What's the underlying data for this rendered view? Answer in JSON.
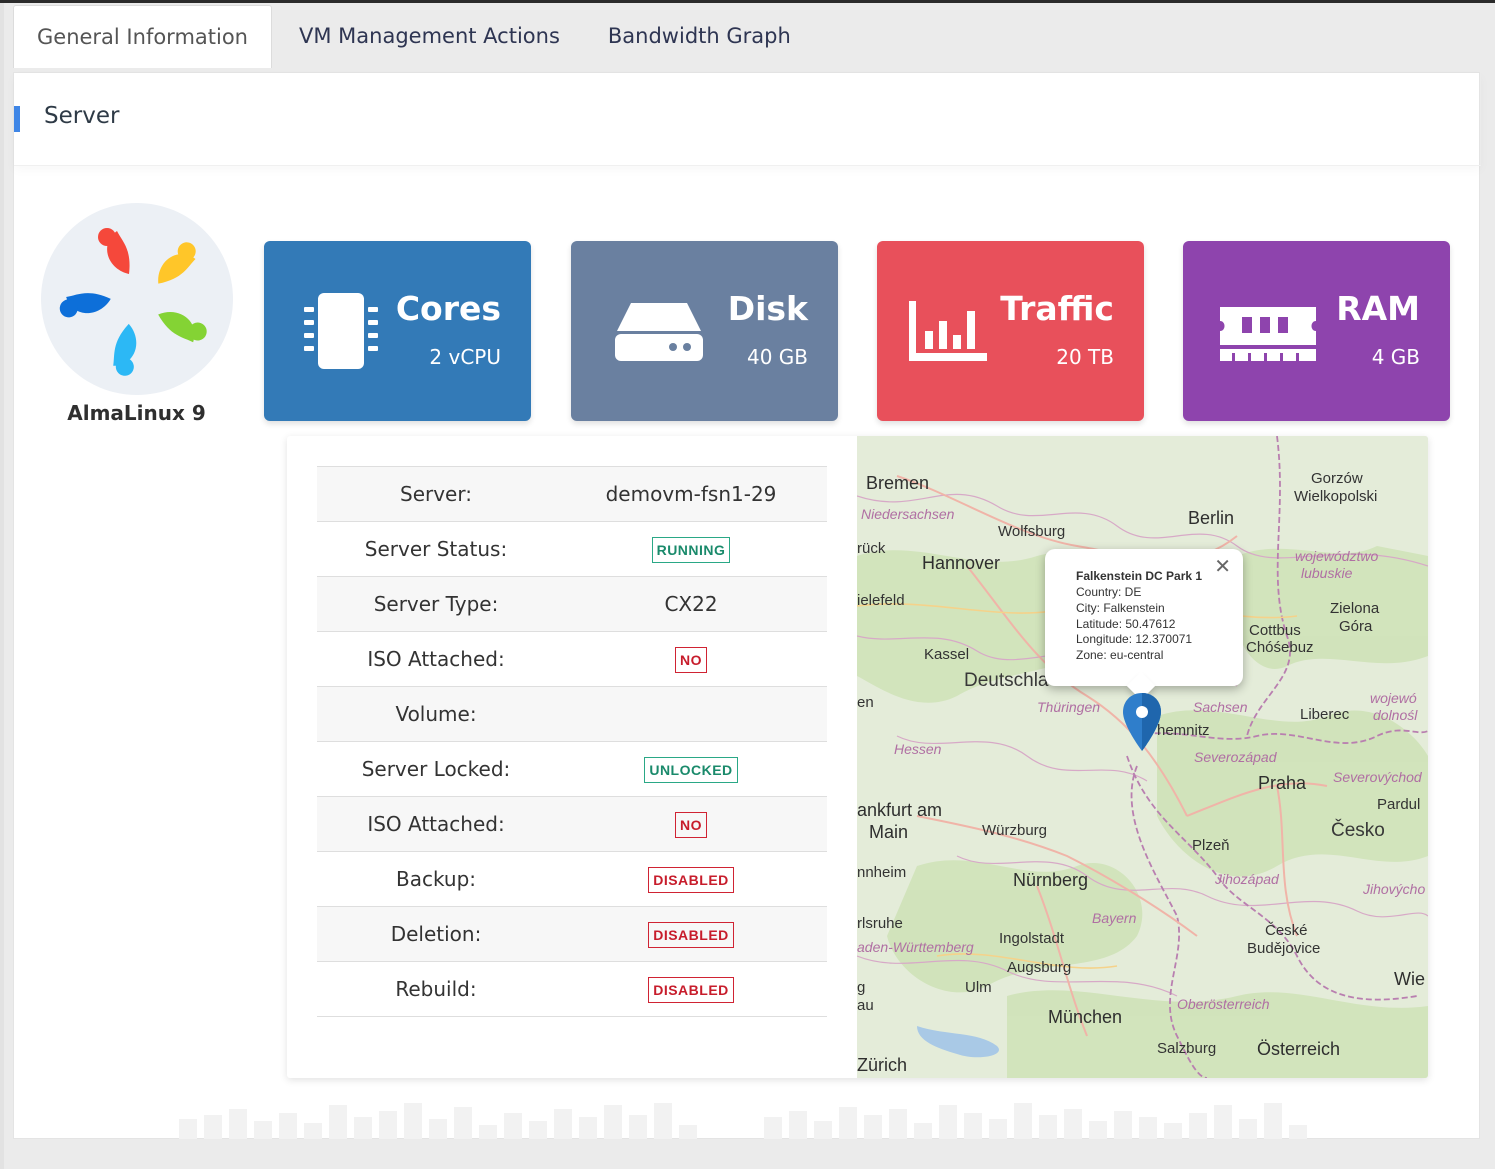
{
  "tabs": [
    {
      "label": "General Information",
      "active": true
    },
    {
      "label": "VM Management Actions",
      "active": false
    },
    {
      "label": "Bandwidth Graph",
      "active": false
    }
  ],
  "panel": {
    "title": "Server"
  },
  "os": {
    "name": "AlmaLinux 9",
    "logo_icon": "almalinux-logo-icon"
  },
  "cards": [
    {
      "title": "Cores",
      "value": "2 vCPU",
      "icon": "cpu-chip-icon",
      "color": "#337ab7"
    },
    {
      "title": "Disk",
      "value": "40 GB",
      "icon": "hard-drive-icon",
      "color": "#6a80a0"
    },
    {
      "title": "Traffic",
      "value": "20 TB",
      "icon": "bar-chart-icon",
      "color": "#e8505b"
    },
    {
      "title": "RAM",
      "value": "4 GB",
      "icon": "memory-module-icon",
      "color": "#8e44ad"
    }
  ],
  "details": [
    {
      "key": "Server:",
      "value": "demovm-fsn1-29",
      "badge": null
    },
    {
      "key": "Server Status:",
      "value": "RUNNING",
      "badge": "green"
    },
    {
      "key": "Server Type:",
      "value": "CX22",
      "badge": null
    },
    {
      "key": "ISO Attached:",
      "value": "NO",
      "badge": "red"
    },
    {
      "key": "Volume:",
      "value": "",
      "badge": null
    },
    {
      "key": "Server Locked:",
      "value": "UNLOCKED",
      "badge": "green"
    },
    {
      "key": "ISO Attached:",
      "value": "NO",
      "badge": "red"
    },
    {
      "key": "Backup:",
      "value": "DISABLED",
      "badge": "red"
    },
    {
      "key": "Deletion:",
      "value": "DISABLED",
      "badge": "red"
    },
    {
      "key": "Rebuild:",
      "value": "DISABLED",
      "badge": "red"
    }
  ],
  "popup": {
    "title": "Falkenstein DC Park 1",
    "lines": [
      "Country: DE",
      "City: Falkenstein",
      "Latitude: 50.47612",
      "Longitude: 12.370071",
      "Zone: eu-central"
    ],
    "close": "✕"
  },
  "map_labels": {
    "bremen": "Bremen",
    "gorzow": "Gorzów",
    "wielkopolski": "Wielkopolski",
    "berlin": "Berlin",
    "niedersachsen": "Niedersachsen",
    "wolfsburg": "Wolfsburg",
    "ruck": "rück",
    "hannover": "Hannover",
    "wojewodztwo": "województwo",
    "lubuskie": "lubuskie",
    "bielefeld": "ielefeld",
    "zielona": "Zielona",
    "gora": "Góra",
    "cottbus": "Cottbus",
    "chosebuz": "Chóśebuz",
    "kassel": "Kassel",
    "deutschland": "Deutschla",
    "en": "en",
    "thuringen": "Thüringen",
    "sachsen": "Sachsen",
    "liberec": "Liberec",
    "wojewod": "wojewó",
    "dolnosl": "dolnośl",
    "chemnitz": "hemnitz",
    "hessen": "Hessen",
    "severozapad": "Severozápad",
    "praha": "Praha",
    "severovychod": "Severovýchod",
    "pardubice": "Pardul",
    "frankfurt": "ankfurt am",
    "main": "Main",
    "wurzburg": "Würzburg",
    "cesko": "Česko",
    "plzen": "Plzeň",
    "mannheim": "nnheim",
    "nurnberg": "Nürnberg",
    "jihozapad": "Jihozápad",
    "jihovychod": "Jihovýcho",
    "karlsruhe": "rlsruhe",
    "bayern": "Bayern",
    "baden": "aden-Württemberg",
    "ingolstadt": "Ingolstadt",
    "ceske": "České",
    "budejovice": "Budějovice",
    "augsburg": "Augsburg",
    "ulm": "Ulm",
    "g": "g",
    "au": "au",
    "wien": "Wie",
    "oberosterreich": "Oberösterreich",
    "munchen": "München",
    "zurich": "Zürich",
    "salzburg": "Salzburg",
    "osterreich": "Österreich"
  }
}
